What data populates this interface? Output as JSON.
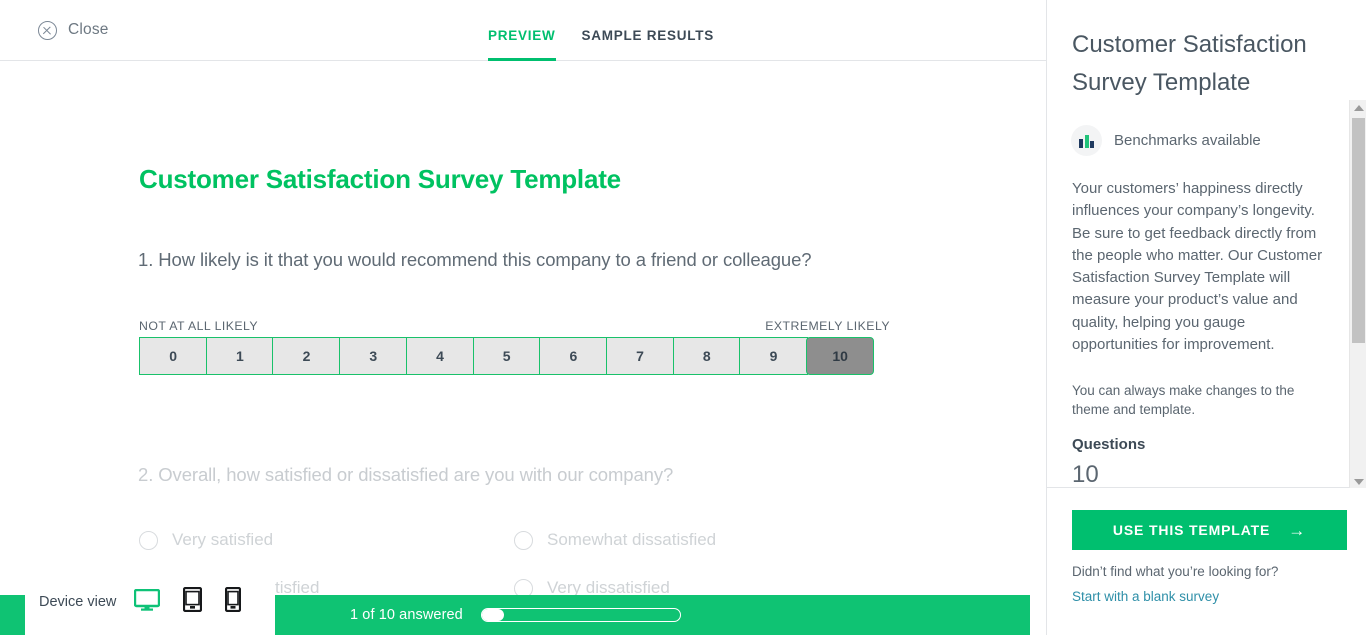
{
  "topbar": {
    "close_label": "Close",
    "close_icon": "close-circle-icon",
    "tabs": [
      {
        "label": "PREVIEW",
        "active": true
      },
      {
        "label": "SAMPLE RESULTS",
        "active": false
      }
    ]
  },
  "survey": {
    "title": "Customer Satisfaction Survey Template",
    "question1": {
      "text": "1. How likely is it that you would recommend this company to a friend or colleague?",
      "left_label": "NOT AT ALL LIKELY",
      "right_label": "EXTREMELY LIKELY",
      "scale": [
        "0",
        "1",
        "2",
        "3",
        "4",
        "5",
        "6",
        "7",
        "8",
        "9",
        "10"
      ],
      "selected": "10"
    },
    "question2": {
      "text": "2. Overall, how satisfied or dissatisfied are you with our company?",
      "options": [
        "Very satisfied",
        "Somewhat dissatisfied",
        "Somewhat satisfied",
        "Very dissatisfied"
      ]
    }
  },
  "bottombar": {
    "progress_text": "1 of 10 answered",
    "progress_percent": 10
  },
  "device_view": {
    "label": "Device view",
    "icons": [
      "desktop-icon",
      "tablet-icon",
      "mobile-icon"
    ],
    "active": "desktop-icon"
  },
  "sidebar": {
    "title": "Customer Satisfaction Survey Template",
    "benchmark_icon": "bar-chart-icon",
    "benchmark_text": "Benchmarks available",
    "description": "Your customers’ happiness directly influences your company’s longevity. Be sure to get feedback directly from the people who matter. Our Customer Satisfaction Survey Template will measure your product’s value and quality, helping you gauge opportunities for improvement.",
    "note": "You can always make changes to the theme and template.",
    "questions_label": "Questions",
    "questions_count": "10",
    "use_template_label": "USE THIS TEMPLATE",
    "use_template_arrow": "→",
    "not_found_text": "Didn’t find what you’re looking for?",
    "blank_survey_link": "Start with a blank survey"
  },
  "colors": {
    "brand_green": "#00bf6f",
    "scale_border_green": "#19c16a",
    "scale_fill": "#e7e7e7",
    "selected_fill": "#8e8e8e",
    "bottom_bar_green": "#0fc373",
    "link_blue": "#2e8fa8",
    "text_gray": "#5b6670"
  }
}
